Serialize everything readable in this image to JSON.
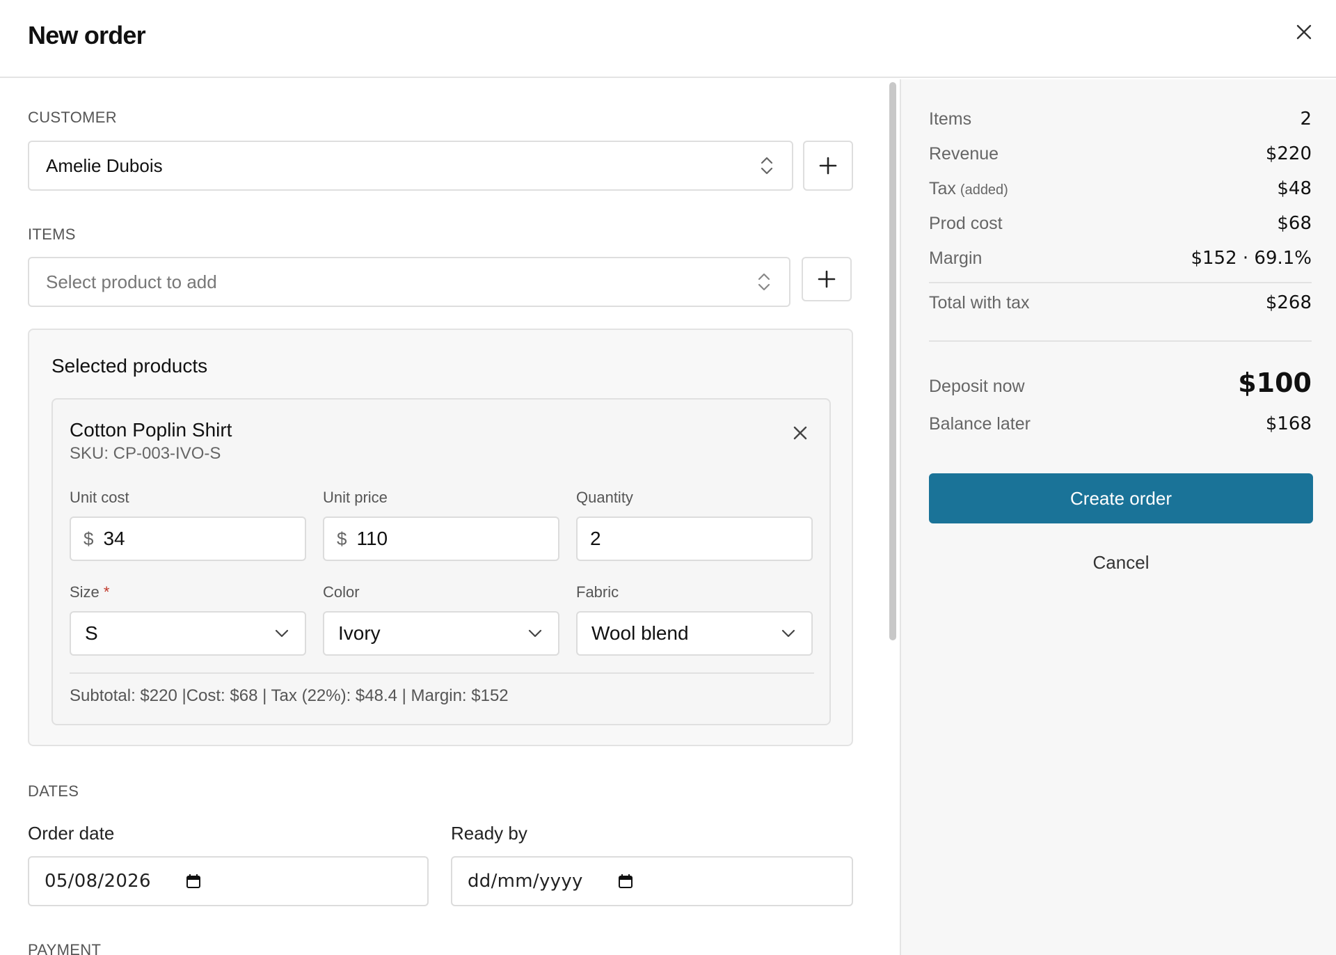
{
  "header": {
    "title": "New order"
  },
  "customer": {
    "section_label": "CUSTOMER",
    "selected": "Amelie Dubois"
  },
  "items": {
    "section_label": "ITEMS",
    "placeholder": "Select product to add"
  },
  "selected_products": {
    "title": "Selected products",
    "products": [
      {
        "name": "Cotton Poplin Shirt",
        "sku": "SKU: CP-003-IVO-S",
        "unit_cost_label": "Unit cost",
        "unit_cost": "34",
        "unit_price_label": "Unit price",
        "unit_price": "110",
        "quantity_label": "Quantity",
        "quantity": "2",
        "size_label": "Size",
        "size_required_mark": "*",
        "size": "S",
        "color_label": "Color",
        "color": "Ivory",
        "fabric_label": "Fabric",
        "fabric": "Wool blend",
        "summary": "Subtotal: $220 |Cost: $68 | Tax (22%): $48.4 | Margin: $152",
        "currency_symbol": "$"
      }
    ]
  },
  "dates": {
    "section_label": "DATES",
    "order_date_label": "Order date",
    "order_date": "05/08/2026",
    "ready_by_label": "Ready by",
    "ready_by": "dd/mm/yyyy"
  },
  "payment": {
    "section_label": "PAYMENT"
  },
  "summary": {
    "items_label": "Items",
    "items_value": "2",
    "revenue_label": "Revenue",
    "revenue_value": "$220",
    "tax_label": "Tax",
    "tax_note": "(added)",
    "tax_value": "$48",
    "prod_cost_label": "Prod cost",
    "prod_cost_value": "$68",
    "margin_label": "Margin",
    "margin_value": "$152 · 69.1%",
    "total_label": "Total with tax",
    "total_value": "$268",
    "deposit_label": "Deposit now",
    "deposit_value": "$100",
    "balance_label": "Balance later",
    "balance_value": "$168",
    "create_button": "Create order",
    "cancel_button": "Cancel"
  },
  "colors": {
    "primary": "#1a7398",
    "required": "#c0392b",
    "sidebar_bg": "#f7f7f7"
  },
  "icons": {
    "close": "close-icon",
    "plus": "plus-icon",
    "updown": "updown-chevron-icon",
    "chevron": "chevron-down-icon",
    "calendar": "calendar-icon"
  }
}
